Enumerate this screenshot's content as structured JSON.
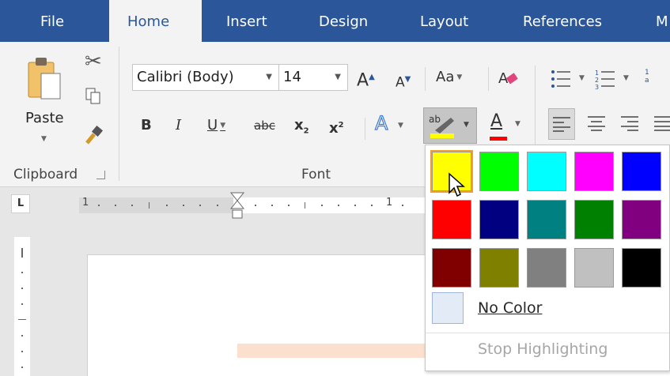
{
  "tabs": [
    "File",
    "Home",
    "Insert",
    "Design",
    "Layout",
    "References",
    "M"
  ],
  "clipboard": {
    "paste_label": "Paste",
    "group_label": "Clipboard"
  },
  "font": {
    "font_name": "Calibri (Body)",
    "font_size": "14",
    "change_case_label": "Aa",
    "bold": "B",
    "italic": "I",
    "underline": "U",
    "strikethrough": "abc",
    "subscript": "x",
    "superscript": "x",
    "group_label": "Font"
  },
  "ruler": {
    "tab_selector": "L",
    "numbers": [
      "1",
      "1"
    ]
  },
  "highlight_menu": {
    "colors": [
      [
        "#ffff00",
        "#00ff00",
        "#00ffff",
        "#ff00ff",
        "#0000ff"
      ],
      [
        "#ff0000",
        "#000080",
        "#008080",
        "#008000",
        "#800080"
      ],
      [
        "#800000",
        "#808000",
        "#808080",
        "#c0c0c0",
        "#000000"
      ]
    ],
    "selected_color": "#ffff00",
    "no_color_label": "No Color",
    "stop_label": "Stop Highlighting"
  },
  "colors": {
    "tab_bar": "#2b579a",
    "ribbon": "#f3f3f3",
    "highlight_bar": "#ffff00",
    "font_color_bar": "#ff0000"
  }
}
